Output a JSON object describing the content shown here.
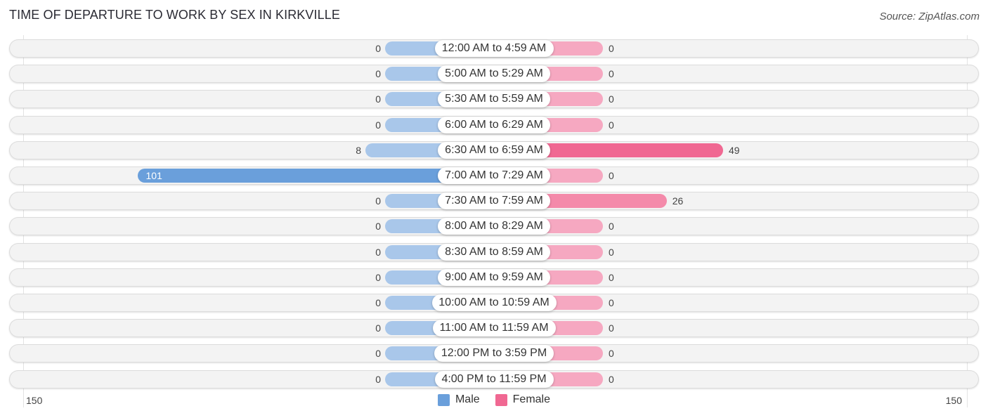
{
  "header": {
    "title": "TIME OF DEPARTURE TO WORK BY SEX IN KIRKVILLE",
    "source": "Source: ZipAtlas.com"
  },
  "colors": {
    "male": "#6a9fdb",
    "male_light": "#a9c7ea",
    "female": "#f06892",
    "female_light": "#f6a8c1"
  },
  "legend": [
    {
      "name": "Male",
      "color": "#6a9fdb"
    },
    {
      "name": "Female",
      "color": "#f06892"
    }
  ],
  "axis": {
    "left_label": "150",
    "right_label": "150"
  },
  "chart_data": {
    "type": "bar",
    "orientation": "horizontal-diverging",
    "title": "TIME OF DEPARTURE TO WORK BY SEX IN KIRKVILLE",
    "xlabel": "",
    "ylabel": "",
    "xlim": [
      -150,
      150
    ],
    "legend_position": "bottom-center",
    "categories": [
      "12:00 AM to 4:59 AM",
      "5:00 AM to 5:29 AM",
      "5:30 AM to 5:59 AM",
      "6:00 AM to 6:29 AM",
      "6:30 AM to 6:59 AM",
      "7:00 AM to 7:29 AM",
      "7:30 AM to 7:59 AM",
      "8:00 AM to 8:29 AM",
      "8:30 AM to 8:59 AM",
      "9:00 AM to 9:59 AM",
      "10:00 AM to 10:59 AM",
      "11:00 AM to 11:59 AM",
      "12:00 PM to 3:59 PM",
      "4:00 PM to 11:59 PM"
    ],
    "series": [
      {
        "name": "Male",
        "values": [
          0,
          0,
          0,
          0,
          8,
          101,
          0,
          0,
          0,
          0,
          0,
          0,
          0,
          0
        ]
      },
      {
        "name": "Female",
        "values": [
          0,
          0,
          0,
          0,
          49,
          0,
          26,
          0,
          0,
          0,
          0,
          0,
          0,
          0
        ]
      }
    ],
    "tick_labels": [
      "150",
      "150"
    ]
  }
}
